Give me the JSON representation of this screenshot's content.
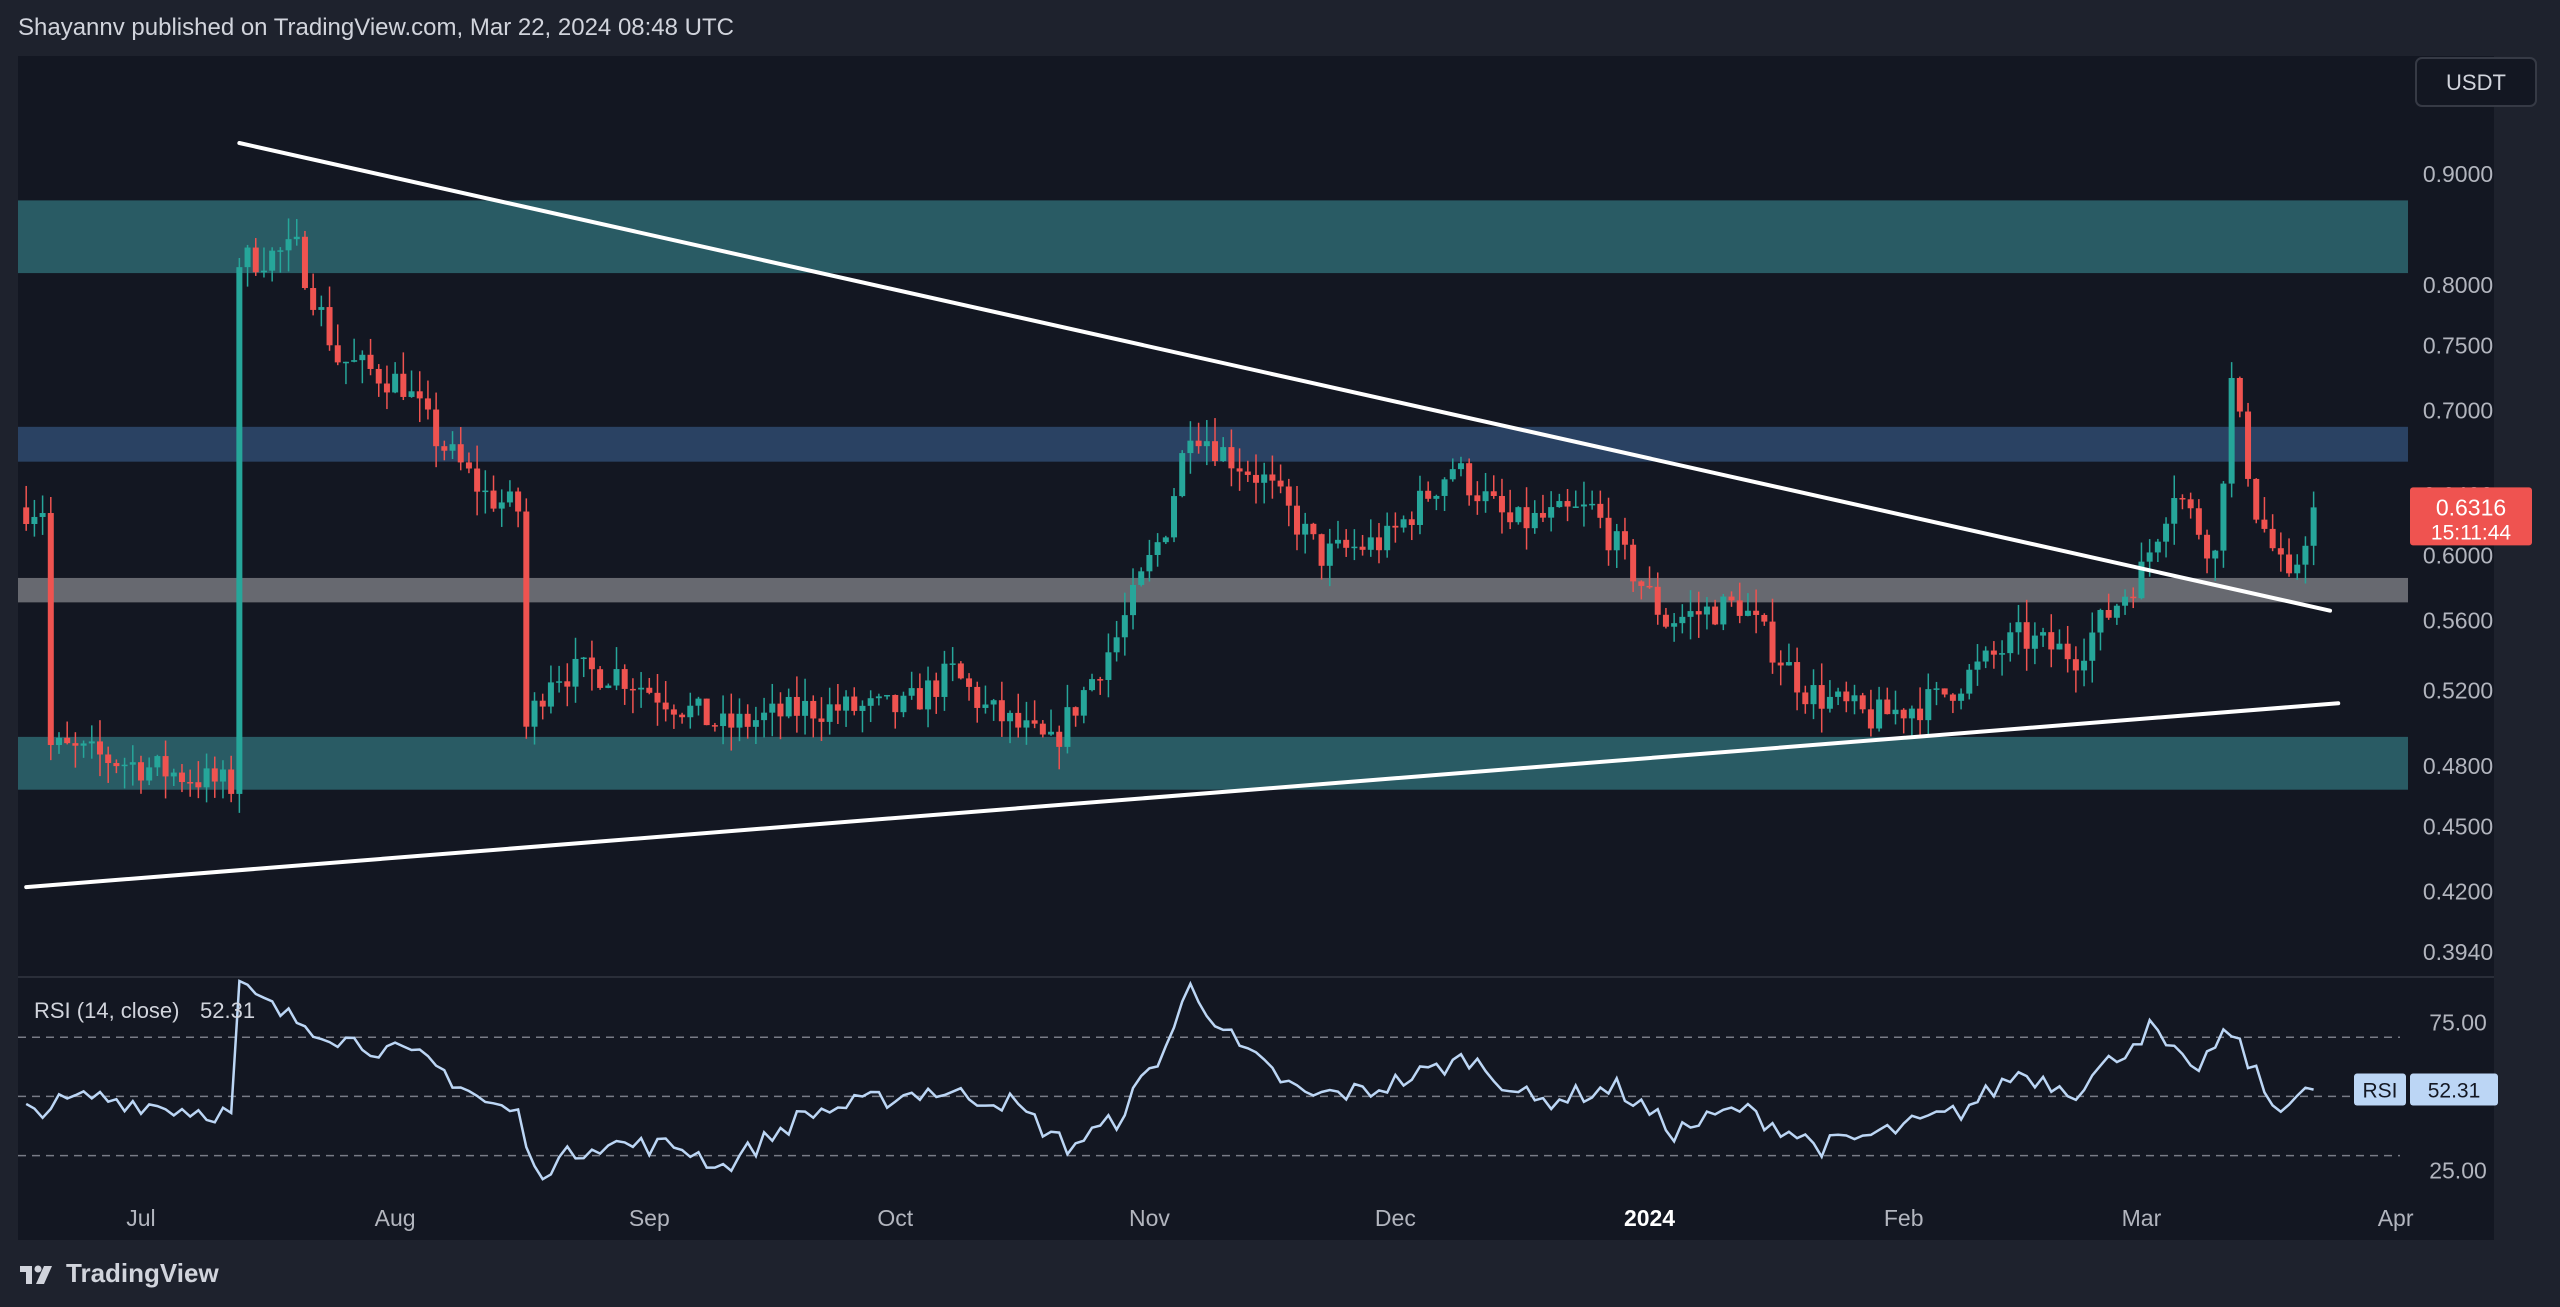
{
  "header": {
    "text": "Shayannv published on TradingView.com, Mar 22, 2024 08:48 UTC"
  },
  "footer": {
    "logo_text": "TradingView",
    "logo_icon": "tradingview-logo-icon"
  },
  "colors": {
    "background": "#1e222d",
    "pane": "#131722",
    "up": "#26a69a",
    "down": "#ef5350",
    "trendline": "#ffffff",
    "zone_teal": "#2a5f68",
    "zone_blue": "#2b4567",
    "zone_gray": "#6b6e75",
    "rsi_line": "#bcd6f5"
  },
  "chart_data": {
    "type": "candlestick",
    "currency_button": "USDT",
    "last_price": {
      "value": "0.6316",
      "countdown": "15:11:44"
    },
    "y_axis": {
      "scale": "log",
      "range": [
        0.384,
        1.02
      ],
      "ticks": [
        "0.9000",
        "0.8000",
        "0.7500",
        "0.7000",
        "0.6400",
        "0.6000",
        "0.5600",
        "0.5200",
        "0.4800",
        "0.4500",
        "0.4200",
        "0.3940"
      ]
    },
    "x_axis": {
      "range": [
        "2024-06-16",
        "2024-04-13"
      ],
      "ticks": [
        {
          "label": "Jul",
          "date": "2023-07-01",
          "bold": false
        },
        {
          "label": "Aug",
          "date": "2023-08-01",
          "bold": false
        },
        {
          "label": "Sep",
          "date": "2023-09-01",
          "bold": false
        },
        {
          "label": "Oct",
          "date": "2023-10-01",
          "bold": false
        },
        {
          "label": "Nov",
          "date": "2023-11-01",
          "bold": false
        },
        {
          "label": "Dec",
          "date": "2023-12-01",
          "bold": false
        },
        {
          "label": "2024",
          "date": "2024-01-01",
          "bold": true
        },
        {
          "label": "Feb",
          "date": "2024-02-01",
          "bold": false
        },
        {
          "label": "Mar",
          "date": "2024-03-01",
          "bold": false
        },
        {
          "label": "Apr",
          "date": "2024-04-01",
          "bold": false
        }
      ]
    },
    "zones": [
      {
        "name": "upper-supply-zone",
        "low": 0.81,
        "high": 0.875,
        "color": "teal"
      },
      {
        "name": "resistance-zone",
        "low": 0.663,
        "high": 0.688,
        "color": "blue"
      },
      {
        "name": "breakout-support-zone",
        "low": 0.571,
        "high": 0.586,
        "color": "gray"
      },
      {
        "name": "lower-demand-zone",
        "low": 0.468,
        "high": 0.495,
        "color": "teal"
      }
    ],
    "trendlines": [
      {
        "name": "descending-trendline",
        "from": {
          "date": "2023-07-13",
          "price": 0.93
        },
        "to": {
          "date": "2024-03-24",
          "price": 0.566
        }
      },
      {
        "name": "ascending-trendline",
        "from": {
          "date": "2023-06-17",
          "price": 0.422
        },
        "to": {
          "date": "2024-03-25",
          "price": 0.513
        }
      }
    ],
    "key_points": [
      {
        "date": "2023-06-20",
        "price": 0.49
      },
      {
        "date": "2023-07-01",
        "price": 0.48
      },
      {
        "date": "2023-07-12",
        "price": 0.47
      },
      {
        "date": "2023-07-13",
        "price": 0.82
      },
      {
        "date": "2023-07-20",
        "price": 0.83
      },
      {
        "date": "2023-07-25",
        "price": 0.74
      },
      {
        "date": "2023-08-02",
        "price": 0.72
      },
      {
        "date": "2023-08-06",
        "price": 0.68
      },
      {
        "date": "2023-08-12",
        "price": 0.64
      },
      {
        "date": "2023-08-16",
        "price": 0.63
      },
      {
        "date": "2023-08-17",
        "price": 0.5
      },
      {
        "date": "2023-08-20",
        "price": 0.53
      },
      {
        "date": "2023-08-28",
        "price": 0.53
      },
      {
        "date": "2023-09-10",
        "price": 0.5
      },
      {
        "date": "2023-09-20",
        "price": 0.51
      },
      {
        "date": "2023-10-02",
        "price": 0.51
      },
      {
        "date": "2023-10-08",
        "price": 0.53
      },
      {
        "date": "2023-10-12",
        "price": 0.51
      },
      {
        "date": "2023-10-20",
        "price": 0.49
      },
      {
        "date": "2023-10-28",
        "price": 0.55
      },
      {
        "date": "2023-11-03",
        "price": 0.62
      },
      {
        "date": "2023-11-06",
        "price": 0.69
      },
      {
        "date": "2023-11-10",
        "price": 0.67
      },
      {
        "date": "2023-11-15",
        "price": 0.65
      },
      {
        "date": "2023-11-22",
        "price": 0.6
      },
      {
        "date": "2023-11-30",
        "price": 0.61
      },
      {
        "date": "2023-12-08",
        "price": 0.66
      },
      {
        "date": "2023-12-15",
        "price": 0.62
      },
      {
        "date": "2023-12-25",
        "price": 0.63
      },
      {
        "date": "2024-01-03",
        "price": 0.56
      },
      {
        "date": "2024-01-12",
        "price": 0.57
      },
      {
        "date": "2024-01-20",
        "price": 0.52
      },
      {
        "date": "2024-01-28",
        "price": 0.505
      },
      {
        "date": "2024-02-05",
        "price": 0.515
      },
      {
        "date": "2024-02-15",
        "price": 0.55
      },
      {
        "date": "2024-02-22",
        "price": 0.54
      },
      {
        "date": "2024-03-01",
        "price": 0.59
      },
      {
        "date": "2024-03-05",
        "price": 0.645
      },
      {
        "date": "2024-03-10",
        "price": 0.6
      },
      {
        "date": "2024-03-12",
        "price": 0.72
      },
      {
        "date": "2024-03-15",
        "price": 0.63
      },
      {
        "date": "2024-03-19",
        "price": 0.58
      },
      {
        "date": "2024-03-22",
        "price": 0.6316
      }
    ],
    "rsi": {
      "label": "RSI (14, close)",
      "current": "52.31",
      "badge_label": "RSI",
      "ylim": [
        15,
        90
      ],
      "levels": [
        {
          "value": 70
        },
        {
          "value": 50
        },
        {
          "value": 30
        }
      ],
      "ticks": [
        "75.00",
        "25.00"
      ],
      "key_points": [
        {
          "date": "2023-06-17",
          "value": 45
        },
        {
          "date": "2023-06-25",
          "value": 50
        },
        {
          "date": "2023-07-05",
          "value": 46
        },
        {
          "date": "2023-07-12",
          "value": 44
        },
        {
          "date": "2023-07-13",
          "value": 87
        },
        {
          "date": "2023-07-18",
          "value": 78
        },
        {
          "date": "2023-07-25",
          "value": 70
        },
        {
          "date": "2023-08-05",
          "value": 62
        },
        {
          "date": "2023-08-12",
          "value": 48
        },
        {
          "date": "2023-08-16",
          "value": 44
        },
        {
          "date": "2023-08-18",
          "value": 24
        },
        {
          "date": "2023-08-25",
          "value": 34
        },
        {
          "date": "2023-09-05",
          "value": 33
        },
        {
          "date": "2023-09-10",
          "value": 26
        },
        {
          "date": "2023-09-20",
          "value": 44
        },
        {
          "date": "2023-10-05",
          "value": 52
        },
        {
          "date": "2023-10-15",
          "value": 48
        },
        {
          "date": "2023-10-22",
          "value": 33
        },
        {
          "date": "2023-10-28",
          "value": 42
        },
        {
          "date": "2023-11-03",
          "value": 67
        },
        {
          "date": "2023-11-06",
          "value": 87
        },
        {
          "date": "2023-11-12",
          "value": 66
        },
        {
          "date": "2023-11-20",
          "value": 50
        },
        {
          "date": "2023-11-28",
          "value": 52
        },
        {
          "date": "2023-12-10",
          "value": 63
        },
        {
          "date": "2023-12-18",
          "value": 48
        },
        {
          "date": "2023-12-28",
          "value": 53
        },
        {
          "date": "2024-01-04",
          "value": 38
        },
        {
          "date": "2024-01-12",
          "value": 46
        },
        {
          "date": "2024-01-22",
          "value": 33
        },
        {
          "date": "2024-01-30",
          "value": 38
        },
        {
          "date": "2024-02-08",
          "value": 45
        },
        {
          "date": "2024-02-15",
          "value": 58
        },
        {
          "date": "2024-02-22",
          "value": 52
        },
        {
          "date": "2024-03-02",
          "value": 73
        },
        {
          "date": "2024-03-07",
          "value": 58
        },
        {
          "date": "2024-03-12",
          "value": 72
        },
        {
          "date": "2024-03-17",
          "value": 47
        },
        {
          "date": "2024-03-22",
          "value": 52.31
        }
      ]
    }
  }
}
